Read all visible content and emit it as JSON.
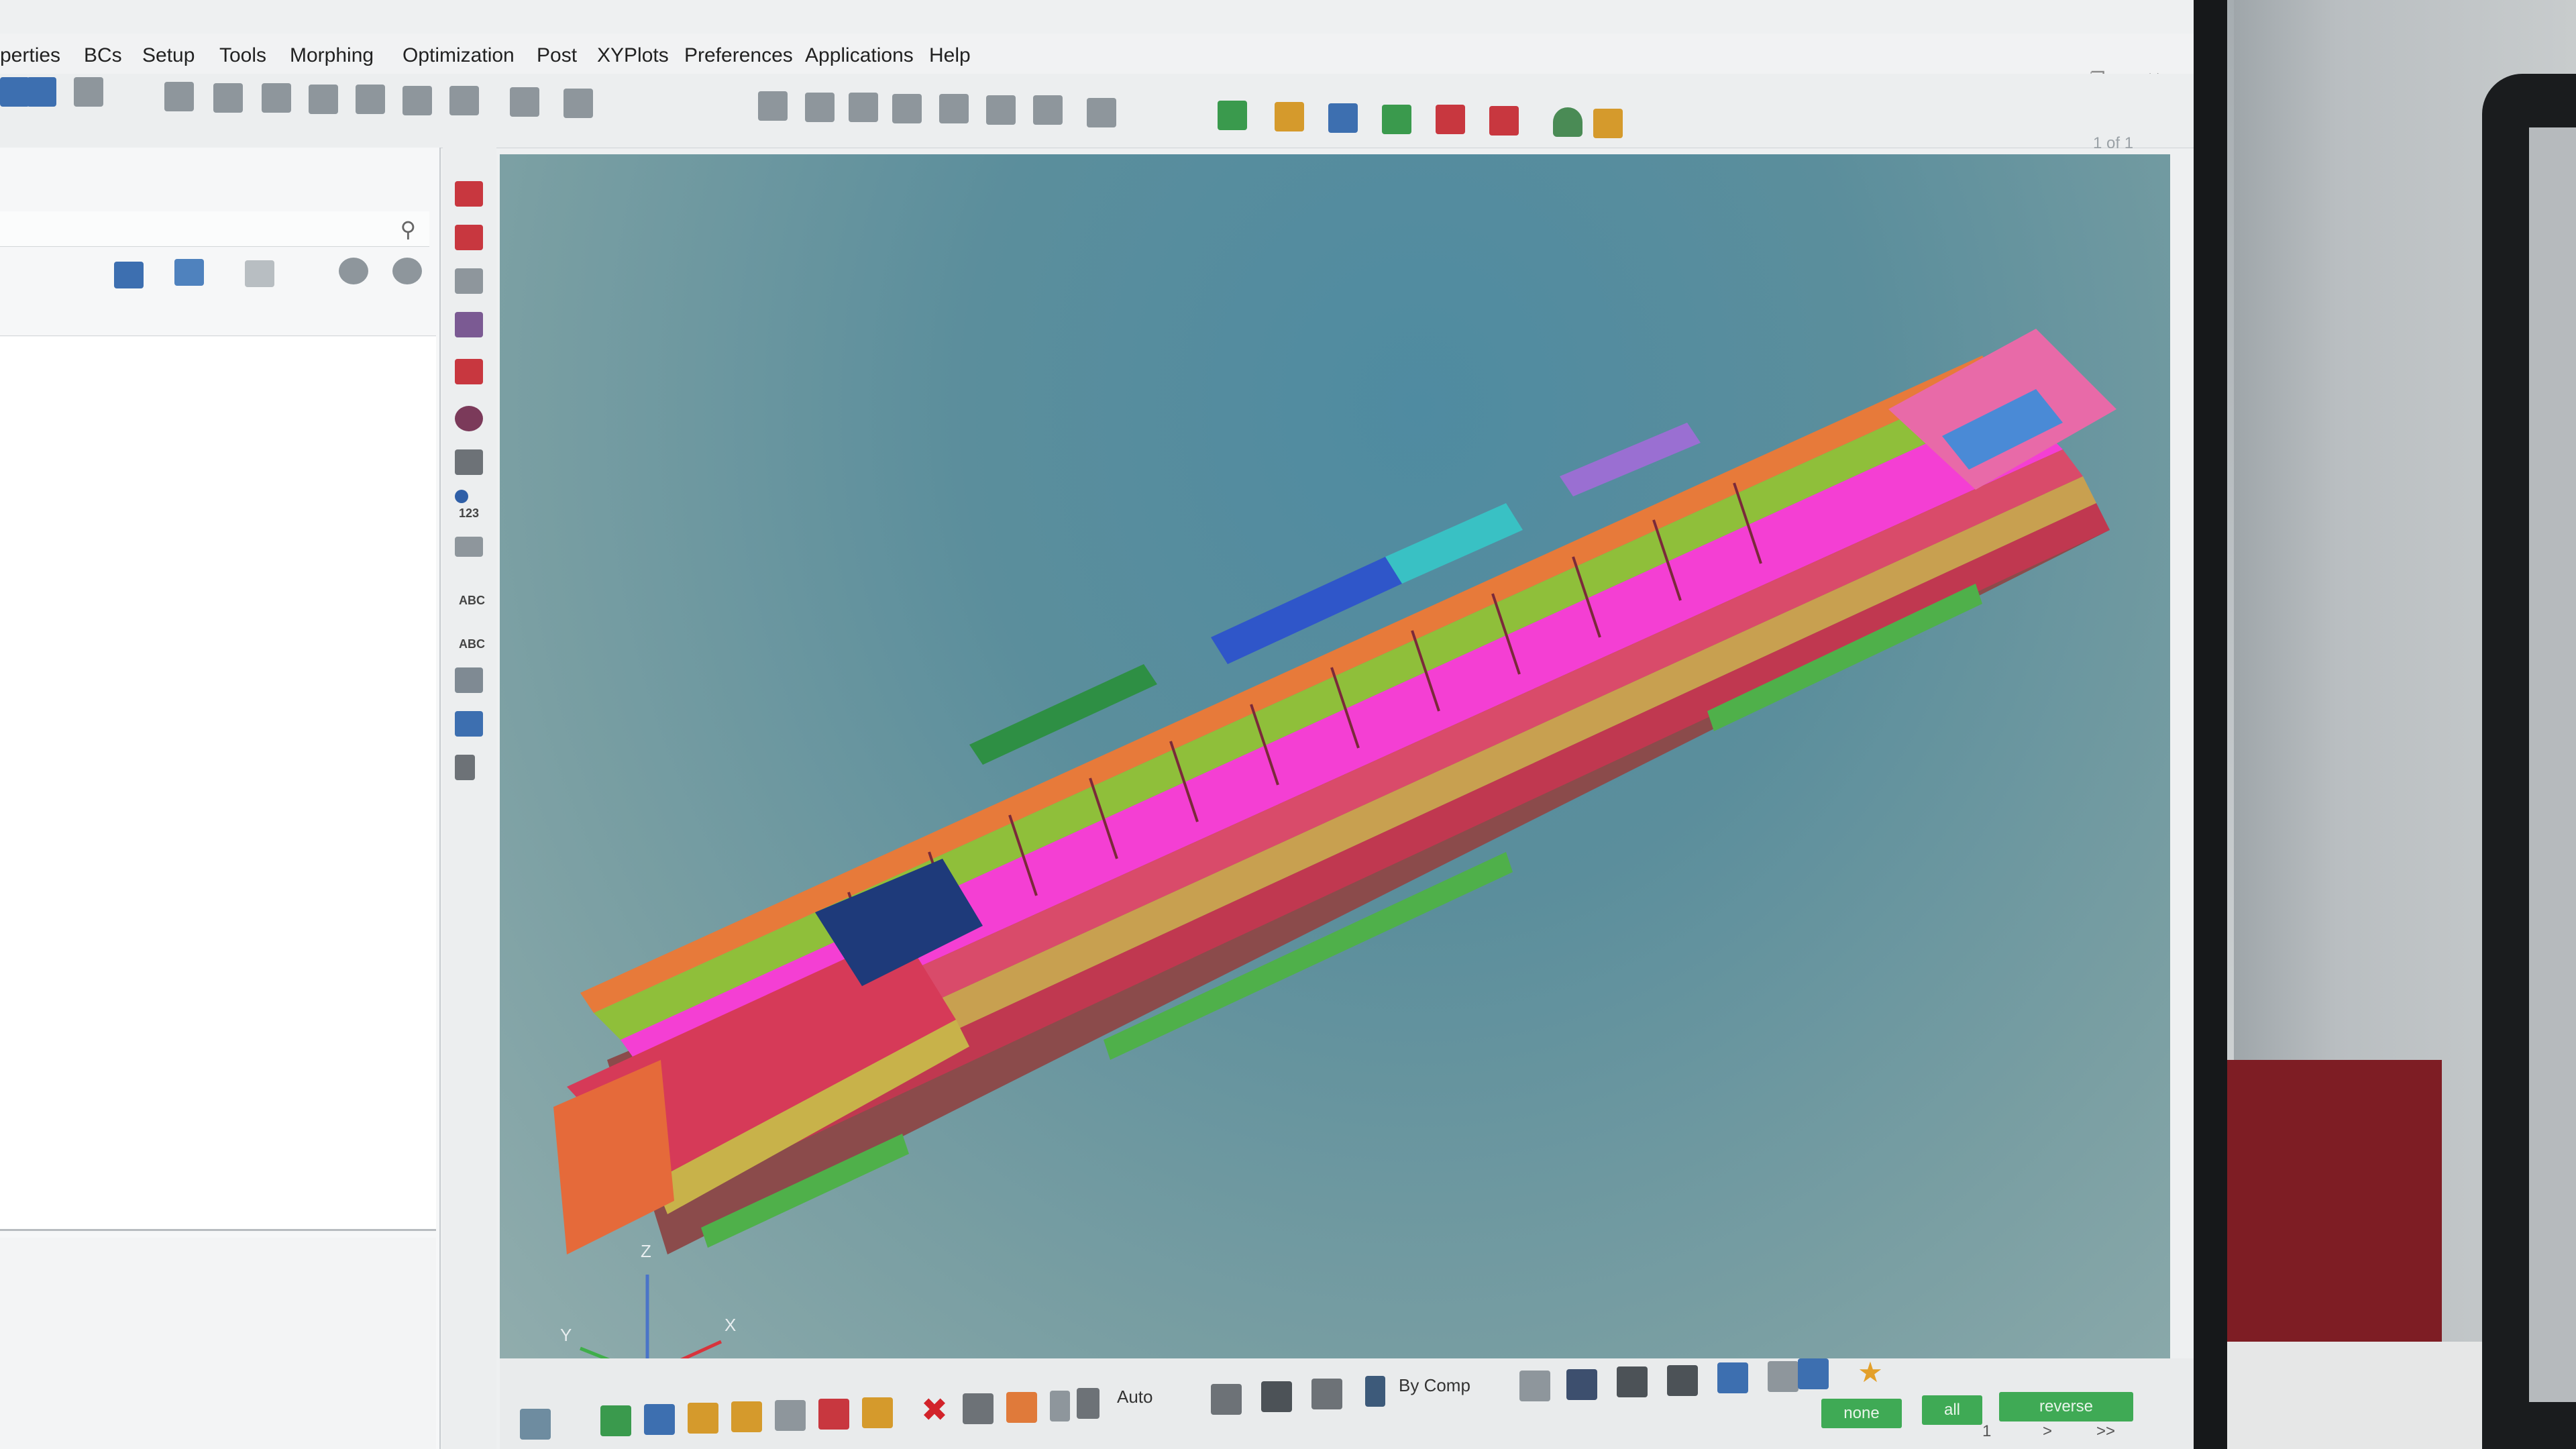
{
  "menubar": {
    "items": [
      "perties",
      "BCs",
      "Setup",
      "Tools",
      "Morphing",
      "Optimization",
      "Post",
      "XYPlots",
      "Preferences",
      "Applications",
      "Help"
    ]
  },
  "window_controls": {
    "minimize": "–",
    "restore": "❐",
    "close": "✕"
  },
  "toolbar": {
    "page_counter": "1 of 1"
  },
  "vertical_toolbar": {
    "label_123": "123",
    "label_abc_1": "ABC",
    "label_abc_2": "ABC"
  },
  "axes": {
    "z": "Z",
    "y": "Y",
    "x": "X"
  },
  "bottom_toolbar": {
    "auto_label": "Auto",
    "by_comp_label": "By Comp",
    "none_button": "none",
    "all_button": "all",
    "reverse_button": "reverse",
    "pager_next": ">",
    "pager_last": ">>",
    "pager_value": "1"
  },
  "colors": {
    "menubar_bg": "#f1f2f3",
    "viewport_top": "#4f8ba1",
    "viewport_bottom": "#93aeae",
    "select_green": "#3faa55"
  },
  "icons": {
    "search": "search-icon",
    "delete": "red-x-icon",
    "favorite": "star-icon"
  }
}
